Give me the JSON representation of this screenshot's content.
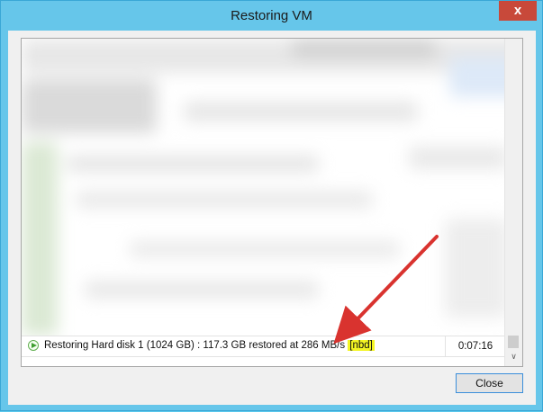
{
  "window": {
    "title": "Restoring VM",
    "close_glyph": "x"
  },
  "log_row": {
    "status_icon": "play-circle-icon",
    "message": "Restoring Hard disk 1 (1024 GB) : 117.3 GB restored at 286 MB/s",
    "transport_mode": "[nbd]",
    "duration": "0:07:16"
  },
  "buttons": {
    "close_label": "Close"
  },
  "colors": {
    "title_bar": "#66c6ea",
    "highlight": "#f3f523",
    "annotation_arrow": "#d9332f",
    "button_focus_border": "#3a8edb"
  }
}
